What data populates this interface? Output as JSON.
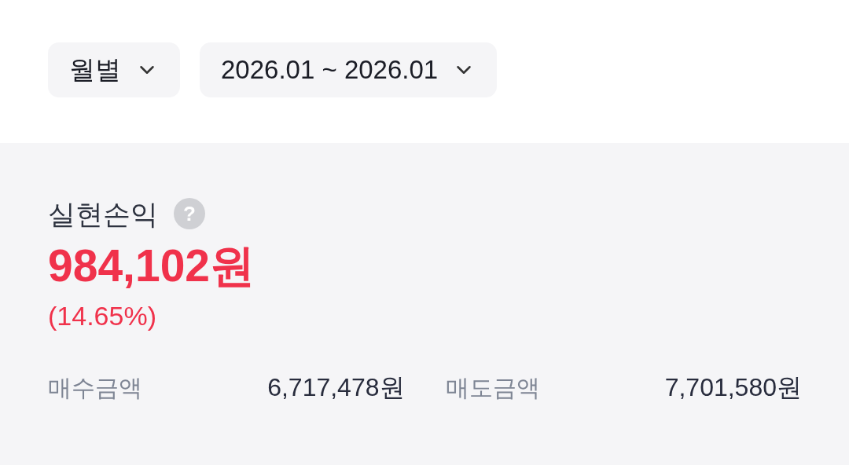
{
  "filters": [
    {
      "label": "월별"
    },
    {
      "label": "2026.01 ~ 2026.01"
    }
  ],
  "summary": {
    "title": "실현손익",
    "amount": "984,102원",
    "rate": "(14.65%)",
    "help": "?"
  },
  "details": [
    {
      "label": "매수금액",
      "value": "6,717,478원"
    },
    {
      "label": "매도금액",
      "value": "7,701,580원"
    }
  ]
}
